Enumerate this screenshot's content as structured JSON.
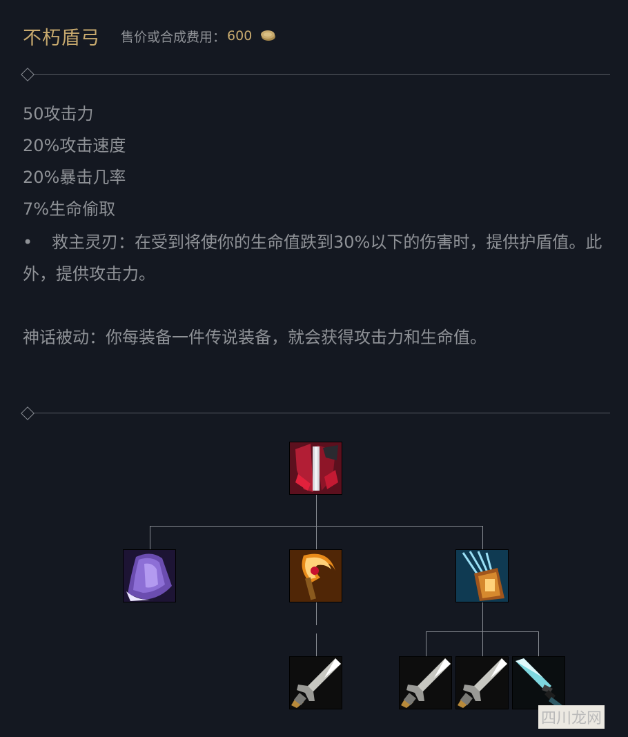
{
  "item": {
    "name": "不朽盾弓",
    "cost_label": "售价或合成费用：",
    "cost_value": "600"
  },
  "stats": [
    "50攻击力",
    "20%攻击速度",
    "20%暴击几率",
    "7%生命偷取"
  ],
  "passive": {
    "bullet": "•",
    "text": "救主灵刃：在受到将使你的生命值跌到30%以下的伤害时，提供护盾值。此外，提供攻击力。"
  },
  "mythic_passive": "神话被动：你每装备一件传说装备，就会获得攻击力和生命值。",
  "build_tree": {
    "root": {
      "icon": "immortal-shieldbow-icon"
    },
    "components": [
      {
        "icon": "cloak-icon"
      },
      {
        "icon": "vampiric-scepter-icon"
      },
      {
        "icon": "noonquiver-icon"
      }
    ],
    "subcomponents": [
      {
        "icon": "long-sword-icon"
      },
      {
        "icon": "long-sword-icon"
      },
      {
        "icon": "long-sword-icon"
      },
      {
        "icon": "dagger-icon"
      }
    ]
  },
  "watermark": {
    "main": "四川龙网",
    "accent": "川"
  },
  "colors": {
    "background": "#141821",
    "gold": "#c8aa6e",
    "text": "#8f9297",
    "line": "#8a8e95"
  }
}
